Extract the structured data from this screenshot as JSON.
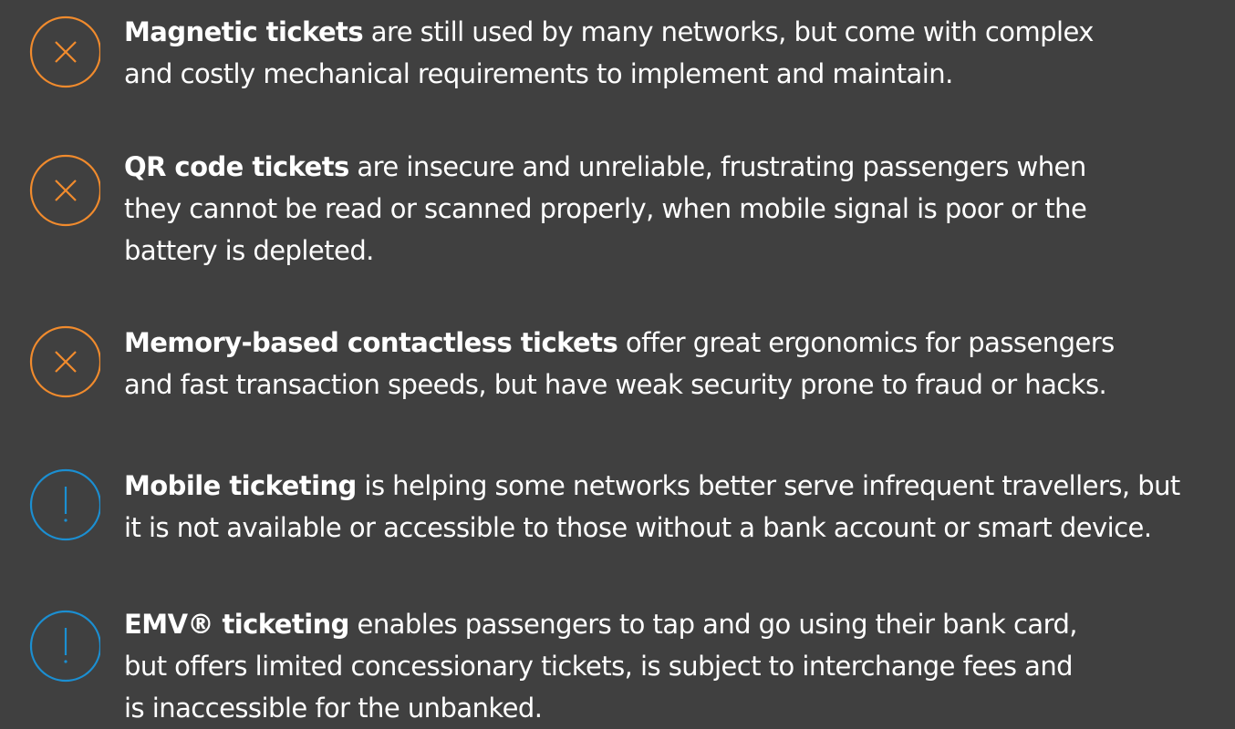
{
  "items": [
    {
      "icon": "x-circle-icon",
      "icon_color": "#F18B2D",
      "title": "Magnetic tickets",
      "lines": [
        " are still used by many networks, but come with complex",
        "and costly mechanical requirements to implement and maintain."
      ]
    },
    {
      "icon": "x-circle-icon",
      "icon_color": "#F18B2D",
      "title": "QR code tickets",
      "lines": [
        " are insecure and unreliable, frustrating passengers when",
        "they cannot be read or scanned properly, when mobile signal is poor or the",
        "battery is depleted."
      ]
    },
    {
      "icon": "x-circle-icon",
      "icon_color": "#F18B2D",
      "title": "Memory-based contactless tickets",
      "lines": [
        " offer great ergonomics for passengers",
        "and fast transaction speeds, but have weak security prone to fraud or hacks."
      ]
    },
    {
      "icon": "exclamation-circle-icon",
      "icon_color": "#1B8FD2",
      "title": "Mobile ticketing",
      "lines": [
        " is helping some networks better serve infrequent travellers, but",
        "it is not available or accessible to those without a bank account or smart device."
      ]
    },
    {
      "icon": "exclamation-circle-icon",
      "icon_color": "#1B8FD2",
      "title": "EMV® ticketing",
      "lines": [
        " enables passengers to tap and go using their bank card,",
        "but offers limited concessionary tickets, is subject to interchange fees and",
        "is inaccessible for the unbanked."
      ]
    }
  ]
}
